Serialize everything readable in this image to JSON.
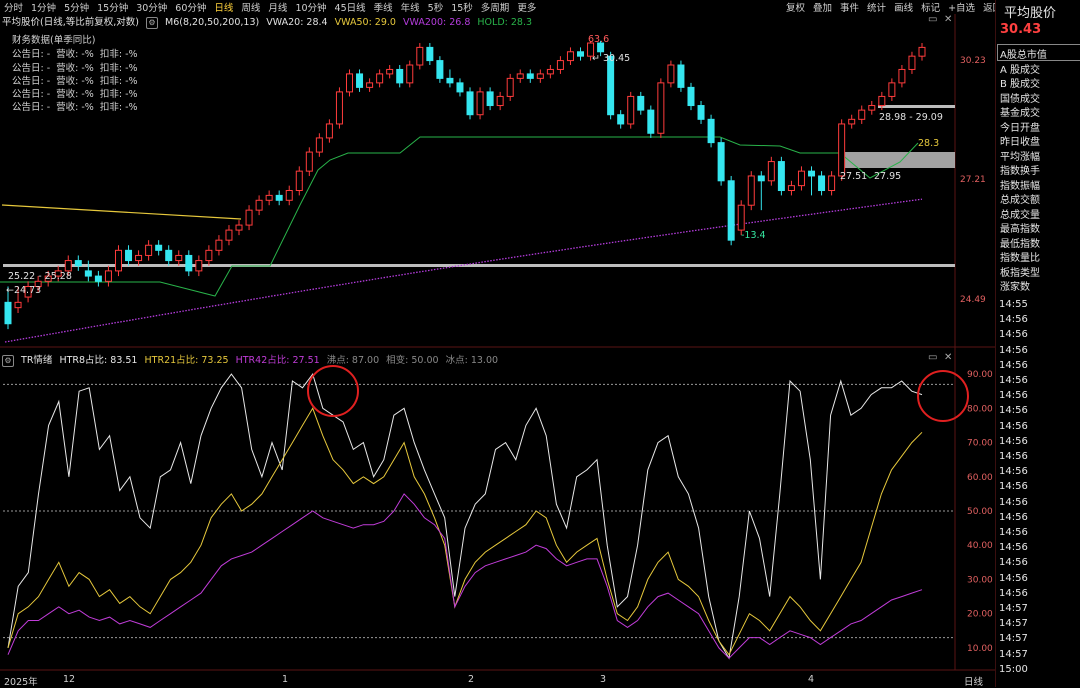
{
  "period_tabs": [
    "分时",
    "1分钟",
    "5分钟",
    "15分钟",
    "30分钟",
    "60分钟",
    "日线",
    "周线",
    "月线",
    "10分钟",
    "45日线",
    "季线",
    "年线",
    "5秒",
    "15秒",
    "多周期",
    "更多"
  ],
  "active_tab": "日线",
  "toolbar": [
    "复权",
    "叠加",
    "事件",
    "统计",
    "画线",
    "标记"
  ],
  "toolbar_add": "+自选",
  "toolbar_back": "返回",
  "main_head": {
    "title": "平均股价(日线,等比前复权,对数)",
    "ma": "M6(8,20,50,200,13)",
    "vwa20": "VWA20: 28.4",
    "vwa50": "VWA50: 29.0",
    "vwa200": "VWA200: 26.8",
    "hold": "HOLD: 28.3"
  },
  "fin": {
    "title": "财务数据(单季同比)",
    "rows": [
      [
        "公告日: -",
        "营收: -%",
        "扣非: -%"
      ],
      [
        "公告日: -",
        "营收: -%",
        "扣非: -%"
      ],
      [
        "公告日: -",
        "营收: -%",
        "扣非: -%"
      ],
      [
        "公告日: -",
        "营收: -%",
        "扣非: -%"
      ],
      [
        "公告日: -",
        "营收: -%",
        "扣非: -%"
      ]
    ]
  },
  "price_axis": [
    "30.23",
    "27.21",
    "24.49"
  ],
  "price_labels": {
    "peak": "63.6",
    "hi": "30.45",
    "zone_top": "28.98 - 29.09",
    "zone_bot": "25.22 - 25.28",
    "lo": "24.73",
    "trough": "-13.4",
    "p1": "27.51",
    "p2": "27.95",
    "hold": "28.3"
  },
  "indicator_head": {
    "name": "TR情绪",
    "h8": "HTR8占比: 83.51",
    "h21": "HTR21占比: 73.25",
    "h42": "HTR42占比: 27.51",
    "boil": "沸点: 87.00",
    "phase": "相变: 50.00",
    "ice": "冰点: 13.00"
  },
  "ind_axis": [
    "90.00",
    "80.00",
    "70.00",
    "60.00",
    "50.00",
    "40.00",
    "30.00",
    "20.00",
    "10.00"
  ],
  "x_axis": {
    "year": "2025年",
    "labels": [
      "12",
      "1",
      "2",
      "3",
      "4"
    ],
    "period": "日线"
  },
  "panel": {
    "name": "平均股价",
    "price": "30.43",
    "items": [
      "A股总市值",
      "A 股成交",
      "B 股成交",
      "国债成交",
      "基金成交",
      "今日开盘",
      "昨日收盘",
      "平均涨幅",
      "指数换手",
      "指数振幅",
      "总成交额",
      "总成交量",
      "最高指数",
      "最低指数",
      "指数量比",
      "板指类型",
      "涨家数"
    ],
    "times": [
      "14:55",
      "14:56",
      "14:56",
      "14:56",
      "14:56",
      "14:56",
      "14:56",
      "14:56",
      "14:56",
      "14:56",
      "14:56",
      "14:56",
      "14:56",
      "14:56",
      "14:56",
      "14:56",
      "14:56",
      "14:56",
      "14:56",
      "14:56",
      "14:57",
      "14:57",
      "14:57",
      "14:57",
      "15:00"
    ]
  },
  "colors": {
    "up": "#ff3c3c",
    "down": "#35e6f0",
    "hold": "#29b34a",
    "vwa200": "#b43cdc",
    "yellow": "#e6c83c",
    "white": "#e8e8e8",
    "circle": "#e02020"
  },
  "chart_data": [
    {
      "type": "candlestick",
      "title": "平均股价(日线,等比前复权,对数)",
      "y_ticks": [
        30.23,
        27.21,
        24.49
      ],
      "candles": [
        [
          25.0,
          24.6,
          25.3,
          24.5
        ],
        [
          24.9,
          25.0,
          25.3,
          24.8
        ],
        [
          25.1,
          25.3,
          25.4,
          25.0
        ],
        [
          25.3,
          25.4,
          25.5,
          25.2
        ],
        [
          25.4,
          25.5,
          25.6,
          25.3
        ],
        [
          25.5,
          25.6,
          25.7,
          25.4
        ],
        [
          25.6,
          25.8,
          25.9,
          25.5
        ],
        [
          25.8,
          25.7,
          25.9,
          25.6
        ],
        [
          25.6,
          25.5,
          25.8,
          25.4
        ],
        [
          25.5,
          25.4,
          25.6,
          25.3
        ],
        [
          25.4,
          25.6,
          25.7,
          25.3
        ],
        [
          25.6,
          26.0,
          26.1,
          25.5
        ],
        [
          26.0,
          25.8,
          26.1,
          25.7
        ],
        [
          25.8,
          25.9,
          26.0,
          25.7
        ],
        [
          25.9,
          26.1,
          26.2,
          25.8
        ],
        [
          26.1,
          26.0,
          26.2,
          25.9
        ],
        [
          26.0,
          25.8,
          26.1,
          25.7
        ],
        [
          25.8,
          25.9,
          26.0,
          25.7
        ],
        [
          25.9,
          25.6,
          26.0,
          25.5
        ],
        [
          25.6,
          25.8,
          25.9,
          25.5
        ],
        [
          25.8,
          26.0,
          26.1,
          25.7
        ],
        [
          26.0,
          26.2,
          26.3,
          25.9
        ],
        [
          26.2,
          26.4,
          26.5,
          26.1
        ],
        [
          26.4,
          26.5,
          26.6,
          26.3
        ],
        [
          26.5,
          26.8,
          26.9,
          26.4
        ],
        [
          26.8,
          27.0,
          27.1,
          26.7
        ],
        [
          27.0,
          27.1,
          27.2,
          26.9
        ],
        [
          27.1,
          27.0,
          27.2,
          26.9
        ],
        [
          27.0,
          27.2,
          27.3,
          26.9
        ],
        [
          27.2,
          27.6,
          27.7,
          27.1
        ],
        [
          27.6,
          28.0,
          28.1,
          27.5
        ],
        [
          28.0,
          28.3,
          28.4,
          27.9
        ],
        [
          28.3,
          28.6,
          28.7,
          28.2
        ],
        [
          28.6,
          29.3,
          29.4,
          28.5
        ],
        [
          29.3,
          29.7,
          29.8,
          29.2
        ],
        [
          29.7,
          29.4,
          29.8,
          29.3
        ],
        [
          29.4,
          29.5,
          29.6,
          29.3
        ],
        [
          29.5,
          29.7,
          29.8,
          29.4
        ],
        [
          29.7,
          29.8,
          29.9,
          29.6
        ],
        [
          29.8,
          29.5,
          29.9,
          29.4
        ],
        [
          29.5,
          29.9,
          30.0,
          29.4
        ],
        [
          29.9,
          30.3,
          30.4,
          29.8
        ],
        [
          30.3,
          30.0,
          30.4,
          29.9
        ],
        [
          30.0,
          29.6,
          30.1,
          29.5
        ],
        [
          29.6,
          29.5,
          29.8,
          29.4
        ],
        [
          29.5,
          29.3,
          29.6,
          29.2
        ],
        [
          29.3,
          28.8,
          29.4,
          28.7
        ],
        [
          28.8,
          29.3,
          29.4,
          28.7
        ],
        [
          29.3,
          29.0,
          29.4,
          28.9
        ],
        [
          29.0,
          29.2,
          29.3,
          28.9
        ],
        [
          29.2,
          29.6,
          29.7,
          29.1
        ],
        [
          29.6,
          29.7,
          29.8,
          29.5
        ],
        [
          29.7,
          29.6,
          29.8,
          29.5
        ],
        [
          29.6,
          29.7,
          29.8,
          29.5
        ],
        [
          29.7,
          29.8,
          29.9,
          29.6
        ],
        [
          29.8,
          30.0,
          30.1,
          29.7
        ],
        [
          30.0,
          30.2,
          30.3,
          29.9
        ],
        [
          30.2,
          30.1,
          30.3,
          30.0
        ],
        [
          30.1,
          30.4,
          30.45,
          30.0
        ],
        [
          30.4,
          30.2,
          30.45,
          30.1
        ],
        [
          30.1,
          28.8,
          30.2,
          28.7
        ],
        [
          28.8,
          28.6,
          28.9,
          28.5
        ],
        [
          28.6,
          29.2,
          29.3,
          28.5
        ],
        [
          29.2,
          28.9,
          29.3,
          28.8
        ],
        [
          28.9,
          28.4,
          29.0,
          28.3
        ],
        [
          28.4,
          29.5,
          29.6,
          28.3
        ],
        [
          29.5,
          29.9,
          30.0,
          29.4
        ],
        [
          29.9,
          29.4,
          30.0,
          29.3
        ],
        [
          29.4,
          29.0,
          29.5,
          28.9
        ],
        [
          29.0,
          28.7,
          29.1,
          28.6
        ],
        [
          28.7,
          28.2,
          28.8,
          28.1
        ],
        [
          28.2,
          27.4,
          28.3,
          27.3
        ],
        [
          27.4,
          26.2,
          27.5,
          26.1
        ],
        [
          26.4,
          26.9,
          27.0,
          26.3
        ],
        [
          26.9,
          27.5,
          27.6,
          26.8
        ],
        [
          27.5,
          27.4,
          27.6,
          26.8
        ],
        [
          27.4,
          27.8,
          27.9,
          27.3
        ],
        [
          27.8,
          27.2,
          27.9,
          27.1
        ],
        [
          27.2,
          27.3,
          27.4,
          27.1
        ],
        [
          27.3,
          27.6,
          27.7,
          27.2
        ],
        [
          27.6,
          27.5,
          27.7,
          27.1
        ],
        [
          27.5,
          27.2,
          27.6,
          27.1
        ],
        [
          27.2,
          27.5,
          27.6,
          27.1
        ],
        [
          27.5,
          28.6,
          28.7,
          27.4
        ],
        [
          28.6,
          28.7,
          28.8,
          28.5
        ],
        [
          28.7,
          28.9,
          29.0,
          28.6
        ],
        [
          28.9,
          29.0,
          29.1,
          28.8
        ],
        [
          29.0,
          29.2,
          29.3,
          28.9
        ],
        [
          29.2,
          29.5,
          29.6,
          29.1
        ],
        [
          29.5,
          29.8,
          29.9,
          29.4
        ],
        [
          29.8,
          30.1,
          30.2,
          29.7
        ],
        [
          30.1,
          30.3,
          30.4,
          30.0
        ]
      ]
    },
    {
      "type": "line",
      "title": "TR情绪",
      "ylim": [
        5,
        95
      ],
      "y_ticks": [
        90,
        80,
        70,
        60,
        50,
        40,
        30,
        20,
        10
      ],
      "series": [
        {
          "name": "HTR8占比",
          "values": [
            10,
            28,
            32,
            55,
            75,
            82,
            60,
            85,
            86,
            68,
            72,
            56,
            60,
            48,
            45,
            60,
            62,
            70,
            58,
            72,
            80,
            86,
            90,
            86,
            68,
            60,
            70,
            62,
            88,
            86,
            90,
            80,
            78,
            76,
            68,
            70,
            60,
            65,
            78,
            80,
            70,
            62,
            55,
            48,
            25,
            45,
            52,
            55,
            68,
            70,
            65,
            75,
            80,
            72,
            52,
            45,
            60,
            62,
            65,
            40,
            22,
            25,
            40,
            62,
            70,
            72,
            60,
            55,
            45,
            25,
            12,
            7,
            25,
            50,
            42,
            25,
            55,
            88,
            85,
            65,
            30,
            78,
            88,
            78,
            80,
            84,
            86,
            86,
            88,
            85,
            84
          ]
        },
        {
          "name": "HTR21占比",
          "values": [
            10,
            20,
            22,
            25,
            30,
            35,
            28,
            32,
            30,
            25,
            27,
            23,
            25,
            22,
            20,
            25,
            30,
            32,
            35,
            40,
            48,
            52,
            55,
            50,
            52,
            55,
            60,
            65,
            70,
            75,
            80,
            72,
            65,
            62,
            58,
            60,
            58,
            60,
            65,
            70,
            60,
            55,
            48,
            40,
            22,
            30,
            35,
            38,
            40,
            42,
            44,
            46,
            50,
            48,
            40,
            35,
            38,
            40,
            42,
            30,
            20,
            18,
            22,
            30,
            35,
            38,
            30,
            28,
            25,
            18,
            12,
            8,
            14,
            20,
            18,
            15,
            20,
            25,
            22,
            18,
            15,
            20,
            25,
            30,
            35,
            45,
            55,
            62,
            66,
            70,
            73
          ]
        },
        {
          "name": "HTR42占比",
          "values": [
            8,
            15,
            18,
            18,
            20,
            22,
            20,
            21,
            19,
            18,
            19,
            17,
            18,
            17,
            16,
            18,
            20,
            22,
            24,
            26,
            30,
            34,
            36,
            37,
            38,
            40,
            42,
            44,
            46,
            48,
            50,
            48,
            47,
            46,
            45,
            46,
            46,
            47,
            50,
            55,
            52,
            48,
            46,
            42,
            22,
            28,
            32,
            34,
            35,
            36,
            37,
            38,
            40,
            39,
            36,
            34,
            35,
            36,
            36,
            28,
            18,
            16,
            18,
            22,
            25,
            26,
            24,
            22,
            20,
            15,
            10,
            7,
            10,
            13,
            13,
            11,
            13,
            15,
            14,
            13,
            11,
            13,
            15,
            17,
            18,
            20,
            22,
            24,
            25,
            26,
            27
          ]
        }
      ]
    }
  ]
}
